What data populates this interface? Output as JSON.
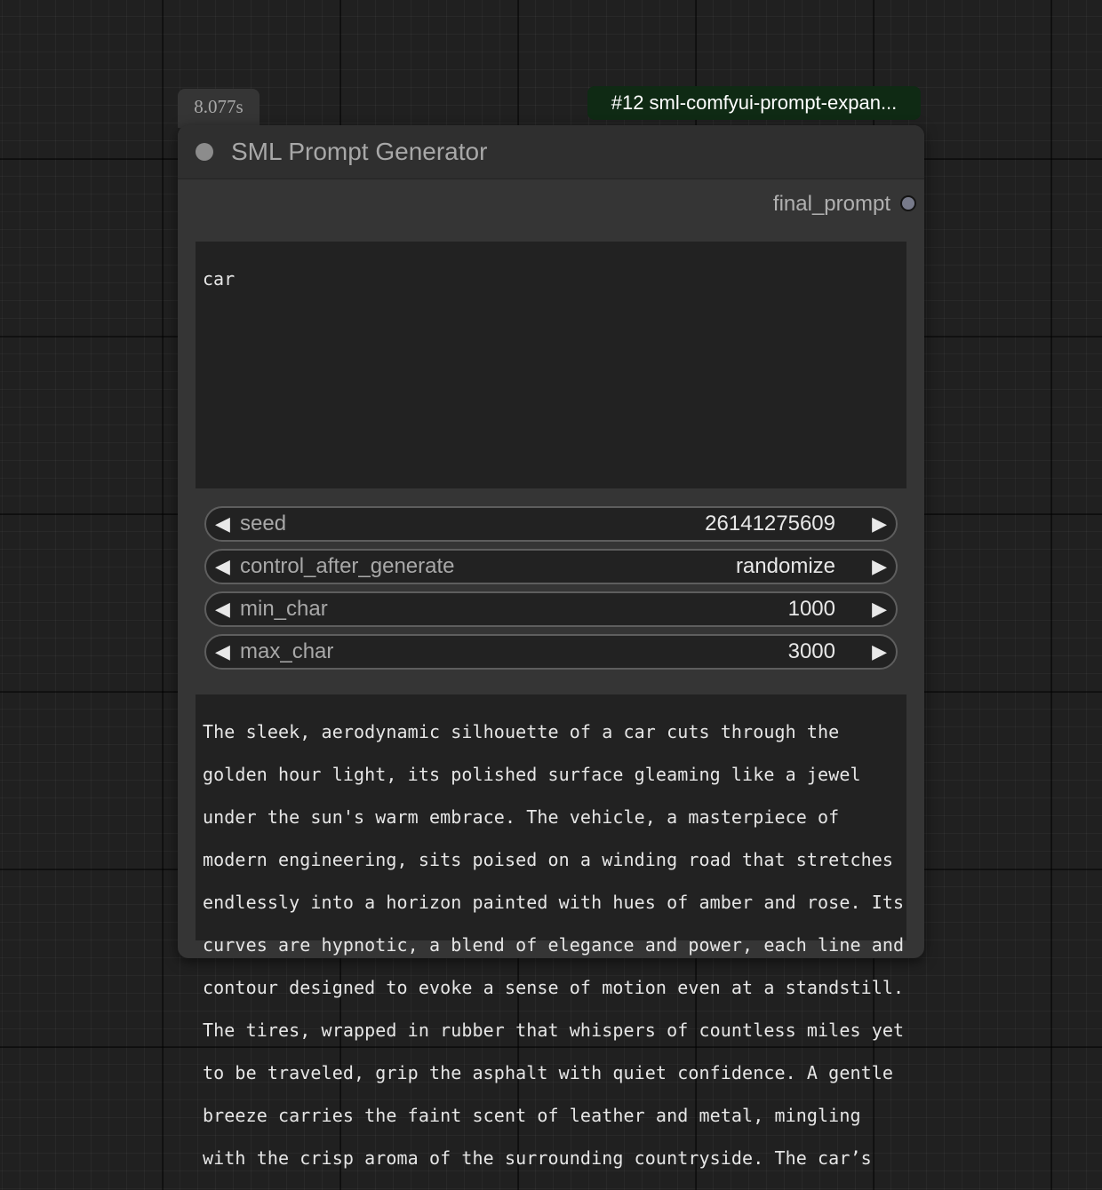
{
  "execution_time": "8.077s",
  "node_id_label": "#12 sml-comfyui-prompt-expan...",
  "node": {
    "title": "SML Prompt Generator",
    "output_name": "final_prompt",
    "prompt_input": "car",
    "widgets": [
      {
        "name": "seed",
        "value": "26141275609"
      },
      {
        "name": "control_after_generate",
        "value": "randomize"
      },
      {
        "name": "min_char",
        "value": "1000"
      },
      {
        "name": "max_char",
        "value": "3000"
      }
    ],
    "arrow_left": "◀",
    "arrow_right": "▶"
  },
  "generated_text_lines": [
    "The sleek, aerodynamic silhouette of a car cuts through the",
    "golden hour light, its polished surface gleaming like a jewel",
    "under the sun's warm embrace. The vehicle, a masterpiece of",
    "modern engineering, sits poised on a winding road that stretches",
    "endlessly into a horizon painted with hues of amber and rose. Its",
    "curves are hypnotic, a blend of elegance and power, each line and",
    "contour designed to evoke a sense of motion even at a standstill.",
    "The tires, wrapped in rubber that whispers of countless miles yet",
    "to be traveled, grip the asphalt with quiet confidence. A gentle",
    "breeze carries the faint scent of leather and metal, mingling",
    "with the crisp aroma of the surrounding countryside. The car’s"
  ]
}
